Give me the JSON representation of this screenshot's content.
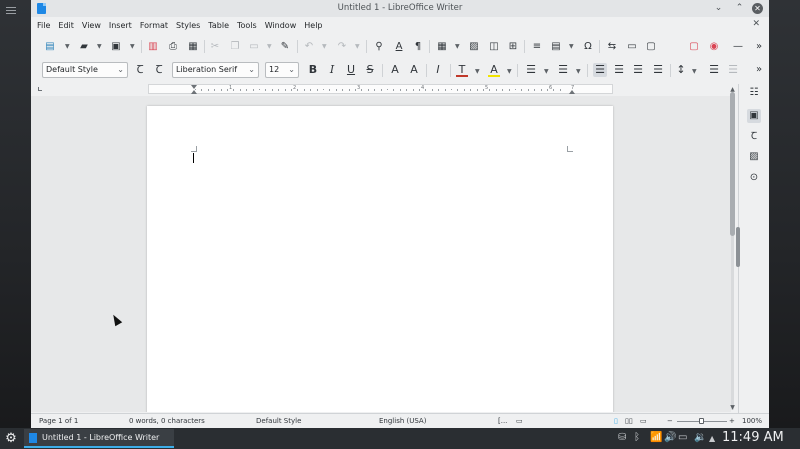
{
  "window": {
    "title": "Untitled 1 - LibreOffice Writer",
    "minimize_glyph": "⌄",
    "maximize_glyph": "⌃",
    "close_glyph": "✕"
  },
  "menubar": {
    "items": [
      "File",
      "Edit",
      "View",
      "Insert",
      "Format",
      "Styles",
      "Table",
      "Tools",
      "Window",
      "Help"
    ],
    "close_glyph": "✕"
  },
  "toolbar_standard": {
    "glyphs": {
      "new": "▤",
      "open": "▰",
      "save": "▣",
      "export_pdf": "▥",
      "print": "⎙",
      "print_preview": "▦",
      "cut": "✂",
      "copy": "❐",
      "paste": "▭",
      "clone": "✎",
      "undo": "↶",
      "redo": "↷",
      "find": "⚲",
      "spelling": "A",
      "formatting_marks": "¶",
      "table": "▦",
      "image": "▨",
      "chart": "◫",
      "textbox": "⊞",
      "page_break": "≡",
      "field": "▤",
      "special_char": "Ω",
      "hyperlink": "⇆",
      "footnote": "▭",
      "comment": "▢",
      "track_changes": "▢",
      "record": "◉",
      "line": "—",
      "more": "»"
    }
  },
  "toolbar_formatting": {
    "paragraph_style": "Default Style",
    "font_name": "Liberation Serif",
    "font_size": "12",
    "glyphs": {
      "update_style": "Ꞇ",
      "new_style": "Ꞇ",
      "bold": "B",
      "italic": "I",
      "underline": "U",
      "strikethrough": "S",
      "superscript": "A",
      "subscript": "A",
      "clear_formatting": "I",
      "font_color": "T",
      "highlight": "A",
      "bullets": "☰",
      "numbering": "☰",
      "align_left": "☰",
      "align_center": "☰",
      "align_right": "☰",
      "justify": "☰",
      "line_spacing": "↕",
      "increase_paragraph_spacing": "☰",
      "decrease_paragraph_spacing": "☰",
      "more": "»"
    },
    "font_color_value": "#c0392b",
    "highlight_color_value": "#f1e400"
  },
  "ruler": {
    "numbers": [
      "1",
      "2",
      "3",
      "4",
      "5",
      "6",
      "7"
    ]
  },
  "sidebar": {
    "glyphs": {
      "settings": "☷",
      "properties": "▣",
      "styles": "Ꞇ",
      "gallery": "▨",
      "navigator": "⊙"
    }
  },
  "statusbar": {
    "page": "Page 1 of 1",
    "words": "0 words, 0 characters",
    "page_style": "Default Style",
    "language": "English (USA)",
    "insert_mode": "[...",
    "selection_mode": "▭",
    "zoom_minus": "−",
    "zoom_plus": "+",
    "zoom": "100%",
    "zoom_fraction": 0.5,
    "view_layout_glyphs": [
      "▯",
      "▯▯",
      "▭"
    ]
  },
  "taskbar": {
    "launcher_glyph": "⚙",
    "task_label": "Untitled 1 - LibreOffice Writer",
    "clock": "11:49 AM",
    "tray_glyphs": [
      "⛁",
      "ᛒ",
      "📶",
      "🔊",
      "▭",
      "🔉",
      "▲"
    ]
  },
  "desktop": {
    "accent_color": "#3daee9"
  }
}
